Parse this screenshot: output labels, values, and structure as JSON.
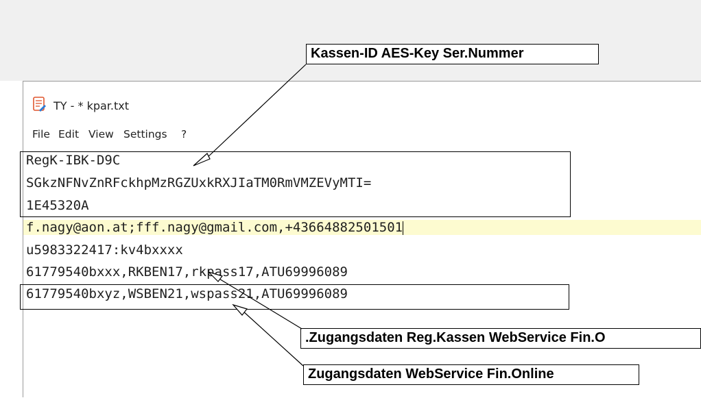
{
  "window": {
    "title": "TY - * kpar.txt",
    "icon": "notepad-document-icon"
  },
  "menu": {
    "items": [
      "File",
      "Edit",
      "View",
      "Settings",
      "?"
    ]
  },
  "editor": {
    "lines": [
      "RegK-IBK-D9C",
      "SGkzNFNvZnRFckhpMzRGZUxkRXJIaTM0RmVMZEVyMTI=",
      "1E45320A",
      "f.nagy@aon.at;fff.nagy@gmail.com,+43664882501501",
      "u5983322417:kv4bxxxx",
      "61779540bxxx,RKBEN17,rkpass17,ATU69996089",
      "61779540bxyz,WSBEN21,wspass21,ATU69996089"
    ],
    "current_line_index": 3
  },
  "annotations": {
    "top_label": "Kassen-ID AES-Key Ser.Nummer",
    "middle_label": ".Zugangsdaten Reg.Kassen WebService Fin.O",
    "bottom_label": "Zugangsdaten WebService Fin.Online"
  }
}
